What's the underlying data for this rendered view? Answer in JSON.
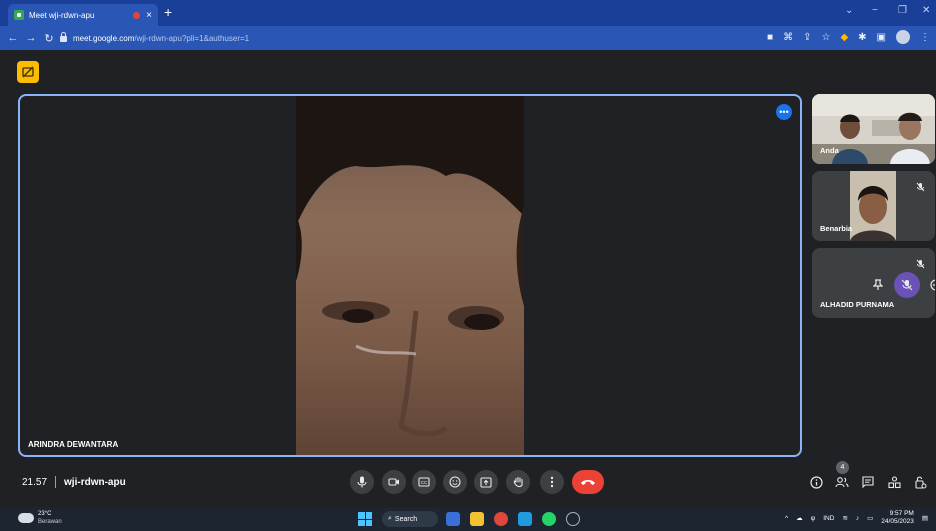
{
  "browser": {
    "tab_title": "Meet  wji-rdwn-apu",
    "tab_close": "×",
    "new_tab": "+",
    "window_controls": [
      "⌄",
      "−",
      "❐",
      "✕"
    ],
    "url_host": "meet.google.com",
    "url_path": "/wji-rdwn-apu?pli=1&authuser=1"
  },
  "meet": {
    "main_participant": "ARINDRA DEWANTARA",
    "more_options_glyph": "•••",
    "participants": [
      {
        "name": "Anda"
      },
      {
        "name": "Benarbia"
      },
      {
        "name": "ALHADID PURNAMA"
      }
    ],
    "meeting_time": "21.57",
    "meeting_code": "wji-rdwn-apu",
    "people_count": "4"
  },
  "taskbar": {
    "weather_temp": "23°C",
    "weather_desc": "Berawan",
    "search_label": "Search",
    "language": "IND",
    "time": "9:57 PM",
    "date": "24/05/2023"
  },
  "colors": {
    "tab_strip": "#1a3f98",
    "toolbar": "#2a57b5",
    "meet_bg": "#202124",
    "tile_bg": "#3c4043",
    "active_border": "#8ab4f8",
    "end_call": "#ea4335",
    "captions_chip": "#fbbc04"
  },
  "icons": [
    "mic-icon",
    "camera-icon",
    "captions-icon",
    "emoji-icon",
    "present-icon",
    "raise-hand-icon",
    "more-vert-icon",
    "end-call-icon",
    "info-icon",
    "people-icon",
    "chat-icon",
    "activities-icon",
    "host-controls-icon"
  ]
}
